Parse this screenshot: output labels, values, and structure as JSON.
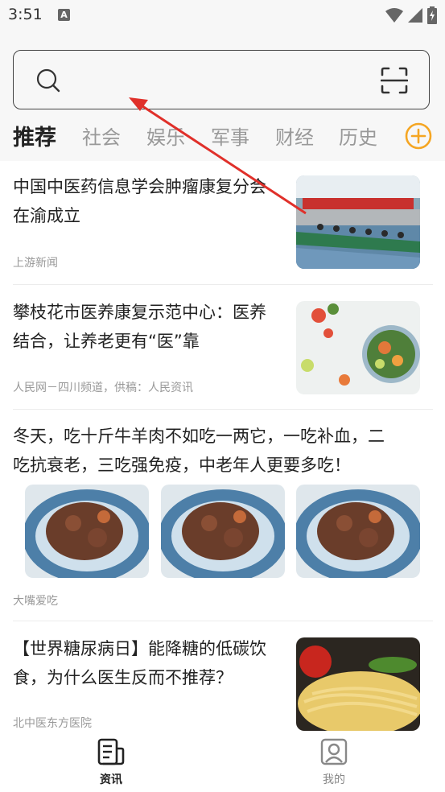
{
  "status_bar": {
    "time": "3:51",
    "notification_icon_letter": "A"
  },
  "search": {
    "placeholder": "",
    "value": ""
  },
  "tabs": [
    {
      "label": "推荐",
      "active": true
    },
    {
      "label": "社会",
      "active": false
    },
    {
      "label": "娱乐",
      "active": false
    },
    {
      "label": "军事",
      "active": false
    },
    {
      "label": "财经",
      "active": false
    },
    {
      "label": "历史",
      "active": false
    }
  ],
  "articles": [
    {
      "title_line1": "中国中医药信息学会肿瘤康复分会",
      "title_line2": "在渝成立",
      "source": "上游新闻",
      "thumbnail": "conference-photo"
    },
    {
      "title_line1": "攀枝花市医养康复示范中心：医养",
      "title_line2": "结合，让养老更有“医”靠",
      "source": "人民网－四川频道，供稿：人民资讯",
      "thumbnail": "salad-photo"
    },
    {
      "title_line1": "冬天，吃十斤牛羊肉不如吃一两它，一吃补血，二",
      "title_line2": "吃抗衰老，三吃强免疫，中老年人更要多吃！",
      "source": "大嘴爱吃",
      "thumbnail": "braised-meat-photo"
    },
    {
      "title_line1": "【世界糖尿病日】能降糖的低碳饮",
      "title_line2": "食，为什么医生反而不推荐？",
      "source": "北中医东方医院",
      "thumbnail": "pasta-photo"
    }
  ],
  "bottom_nav": [
    {
      "label": "资讯",
      "icon": "news-icon",
      "active": true
    },
    {
      "label": "我的",
      "icon": "profile-icon",
      "active": false
    }
  ],
  "colors": {
    "accent": "#f5a623",
    "annotation_arrow": "#e0302a",
    "text_primary": "#222222",
    "text_secondary": "#999999"
  }
}
